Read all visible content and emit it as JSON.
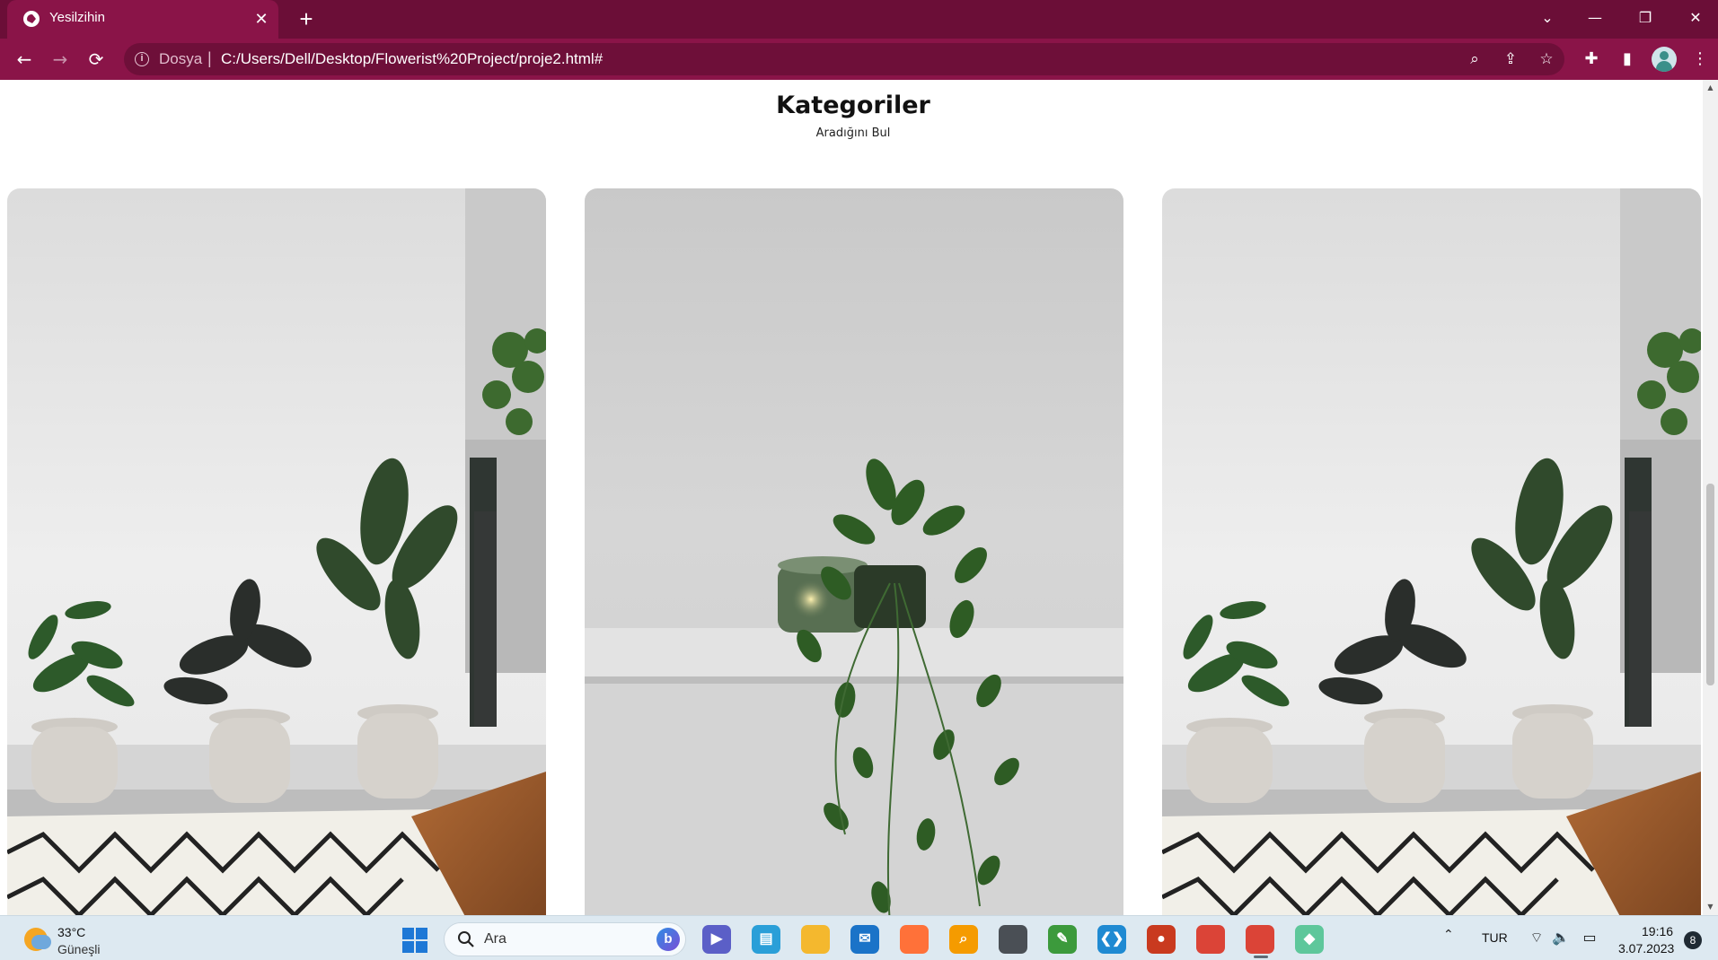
{
  "browser": {
    "tab": {
      "title": "Yesilzihin",
      "close_glyph": "✕",
      "favicon": "globe-icon"
    },
    "new_tab_glyph": "+",
    "window_controls": {
      "tab_search": "⌄",
      "minimize": "—",
      "restore": "❐",
      "close": "✕"
    },
    "nav": {
      "back": "←",
      "forward": "→",
      "reload": "⟳"
    },
    "omnibox": {
      "info_glyph": "i",
      "scheme_label": "Dosya",
      "separator": "|",
      "url": "C:/Users/Dell/Desktop/Flowerist%20Project/proje2.html#",
      "zoom_glyph": "⌕",
      "share_glyph": "⇪",
      "bookmark_glyph": "☆"
    },
    "toolbar": {
      "extensions_glyph": "✚",
      "sidepanel_glyph": "▮",
      "menu_glyph": "⋮"
    }
  },
  "page": {
    "heading": "Kategoriler",
    "subheading": "Aradığını Bul",
    "cards": [
      {
        "name": "category-card-plants-room",
        "image": "potted-plants-room-photo"
      },
      {
        "name": "category-card-hanging-plant",
        "image": "hanging-plant-candle-photo"
      },
      {
        "name": "category-card-plants-room-2",
        "image": "potted-plants-room-photo"
      }
    ]
  },
  "taskbar": {
    "weather": {
      "temperature": "33°C",
      "condition": "Güneşli"
    },
    "search_placeholder": "Ara",
    "bing_glyph": "b",
    "apps": [
      {
        "name": "teams-icon",
        "color": "#5b5fc7",
        "glyph": "▶"
      },
      {
        "name": "notepad-icon",
        "color": "#2a9fd8",
        "glyph": "▤"
      },
      {
        "name": "file-explorer-icon",
        "color": "#f4b82e",
        "glyph": ""
      },
      {
        "name": "mail-icon",
        "color": "#1a73c8",
        "glyph": "✉"
      },
      {
        "name": "firefox-icon",
        "color": "#ff7139",
        "glyph": ""
      },
      {
        "name": "search-app-icon",
        "color": "#f59b00",
        "glyph": "⌕"
      },
      {
        "name": "chat-app-icon",
        "color": "#4a4f55",
        "glyph": ""
      },
      {
        "name": "paint-icon",
        "color": "#3c9a3c",
        "glyph": "✎"
      },
      {
        "name": "vscode-icon",
        "color": "#1f8ad2",
        "glyph": "❮❯"
      },
      {
        "name": "recorder-icon",
        "color": "#c93a1f",
        "glyph": "●"
      },
      {
        "name": "chrome-icon",
        "color": "#db4437",
        "glyph": ""
      },
      {
        "name": "chrome-profile-icon",
        "color": "#db4437",
        "glyph": ""
      },
      {
        "name": "gitkraken-icon",
        "color": "#5ec79b",
        "glyph": "◆"
      }
    ],
    "tray": {
      "chevron": "⌃",
      "language": "TUR",
      "wifi_glyph": "⌔",
      "volume_glyph": "🔈",
      "battery_glyph": "▭"
    },
    "clock": {
      "time": "19:16",
      "date": "3.07.2023"
    },
    "notification_count": "8"
  }
}
